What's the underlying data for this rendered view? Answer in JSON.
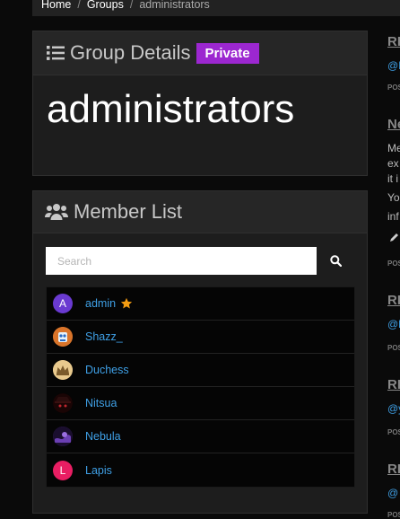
{
  "breadcrumb": {
    "home": "Home",
    "groups": "Groups",
    "current": "administrators"
  },
  "details": {
    "title": "Group Details",
    "badge": "Private",
    "group_name": "administrators"
  },
  "members": {
    "title": "Member List",
    "search_placeholder": "Search",
    "list": [
      {
        "name": "admin",
        "initial": "A",
        "avatar_color": "#6a3ad1",
        "starred": true
      },
      {
        "name": "Shazz_",
        "initial": "",
        "avatar_color": "#d9742a",
        "starred": false
      },
      {
        "name": "Duchess",
        "initial": "",
        "avatar_color": "#e8c98d",
        "starred": false
      },
      {
        "name": "Nitsua",
        "initial": "",
        "avatar_color": "#2a0d0d",
        "starred": false
      },
      {
        "name": "Nebula",
        "initial": "",
        "avatar_color": "#3b1f66",
        "starred": false
      },
      {
        "name": "Lapis",
        "initial": "L",
        "avatar_color": "#e91e63",
        "starred": false
      }
    ]
  },
  "sidebar_fragments": {
    "titles": [
      "RE",
      "Ne",
      "RE",
      "RE",
      "RE"
    ],
    "mentions": [
      "@I",
      "@E",
      "@y",
      "@"
    ],
    "posted": [
      "POS",
      "POS",
      "POS",
      "POS",
      "POS"
    ],
    "body": [
      "Me",
      "ex",
      "it i",
      "Yo",
      "inf"
    ]
  },
  "colors": {
    "accent_link": "#3fa0e6",
    "badge": "#9c27d0",
    "star": "#f39c12"
  }
}
